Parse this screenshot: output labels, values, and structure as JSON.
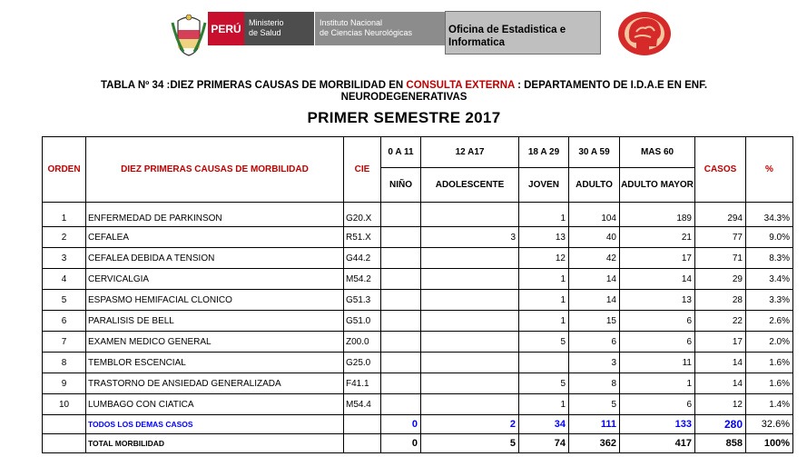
{
  "header": {
    "peru_label": "PERÚ",
    "ministry": [
      "Ministerio",
      "de Salud"
    ],
    "institute": [
      "Instituto Nacional",
      "de Ciencias Neurológicas"
    ],
    "office": [
      "Oficina de Estadistica e",
      "Informatica"
    ],
    "colors": {
      "peru_red": "#c8102e",
      "ministry_gray": "#4d4d4d",
      "institute_gray": "#8c8c8c",
      "office_gray": "#bfbfbf",
      "logo_red": "#d62a2a"
    }
  },
  "title": {
    "part1": "TABLA Nº 34 :DIEZ PRIMERAS CAUSAS DE MORBILIDAD EN ",
    "highlight": "CONSULTA EXTERNA",
    "part2": " : DEPARTAMENTO DE I.D.A.E EN ENF.",
    "line2": "NEURODEGENERATIVAS",
    "subtitle": "PRIMER SEMESTRE  2017"
  },
  "table": {
    "headers": {
      "orden": "ORDEN",
      "causas": "DIEZ PRIMERAS CAUSAS DE MORBILIDAD",
      "cie": "CIE",
      "casos": "CASOS",
      "pct": "%",
      "age_ranges": [
        "0 A 11",
        "12 A17",
        "18 A 29",
        "30 A 59",
        "MAS 60"
      ],
      "age_groups": [
        "NIÑO",
        "ADOLESCENTE",
        "JOVEN",
        "ADULTO",
        "ADULTO MAYOR"
      ]
    },
    "rows": [
      {
        "orden": "1",
        "causa": "ENFERMEDAD DE PARKINSON",
        "cie": "G20.X",
        "nino": "",
        "adol": "",
        "joven": "1",
        "adulto": "104",
        "mayor": "189",
        "casos": "294",
        "pct": "34.3%"
      },
      {
        "orden": "2",
        "causa": "CEFALEA",
        "cie": "R51.X",
        "nino": "",
        "adol": "3",
        "joven": "13",
        "adulto": "40",
        "mayor": "21",
        "casos": "77",
        "pct": "9.0%"
      },
      {
        "orden": "3",
        "causa": "CEFALEA DEBIDA A TENSION",
        "cie": "G44.2",
        "nino": "",
        "adol": "",
        "joven": "12",
        "adulto": "42",
        "mayor": "17",
        "casos": "71",
        "pct": "8.3%"
      },
      {
        "orden": "4",
        "causa": "CERVICALGIA",
        "cie": "M54.2",
        "nino": "",
        "adol": "",
        "joven": "1",
        "adulto": "14",
        "mayor": "14",
        "casos": "29",
        "pct": "3.4%"
      },
      {
        "orden": "5",
        "causa": "ESPASMO HEMIFACIAL CLONICO",
        "cie": "G51.3",
        "nino": "",
        "adol": "",
        "joven": "1",
        "adulto": "14",
        "mayor": "13",
        "casos": "28",
        "pct": "3.3%"
      },
      {
        "orden": "6",
        "causa": "PARALISIS DE BELL",
        "cie": "G51.0",
        "nino": "",
        "adol": "",
        "joven": "1",
        "adulto": "15",
        "mayor": "6",
        "casos": "22",
        "pct": "2.6%"
      },
      {
        "orden": "7",
        "causa": "EXAMEN MEDICO GENERAL",
        "cie": "Z00.0",
        "nino": "",
        "adol": "",
        "joven": "5",
        "adulto": "6",
        "mayor": "6",
        "casos": "17",
        "pct": "2.0%"
      },
      {
        "orden": "8",
        "causa": "TEMBLOR ESCENCIAL",
        "cie": "G25.0",
        "nino": "",
        "adol": "",
        "joven": "",
        "adulto": "3",
        "mayor": "11",
        "casos": "14",
        "pct": "1.6%"
      },
      {
        "orden": "9",
        "causa": "TRASTORNO DE ANSIEDAD GENERALIZADA",
        "cie": "F41.1",
        "nino": "",
        "adol": "",
        "joven": "5",
        "adulto": "8",
        "mayor": "1",
        "casos": "14",
        "pct": "1.6%"
      },
      {
        "orden": "10",
        "causa": "LUMBAGO CON CIATICA",
        "cie": "M54.4",
        "nino": "",
        "adol": "",
        "joven": "1",
        "adulto": "5",
        "mayor": "6",
        "casos": "12",
        "pct": "1.4%"
      }
    ],
    "demas": {
      "label": "TODOS LOS DEMAS CASOS",
      "nino": "0",
      "adol": "2",
      "joven": "34",
      "adulto": "111",
      "mayor": "133",
      "casos": "280",
      "pct": "32.6%"
    },
    "total": {
      "label": "TOTAL MORBILIDAD",
      "nino": "0",
      "adol": "5",
      "joven": "74",
      "adulto": "362",
      "mayor": "417",
      "casos": "858",
      "pct": "100%"
    }
  }
}
